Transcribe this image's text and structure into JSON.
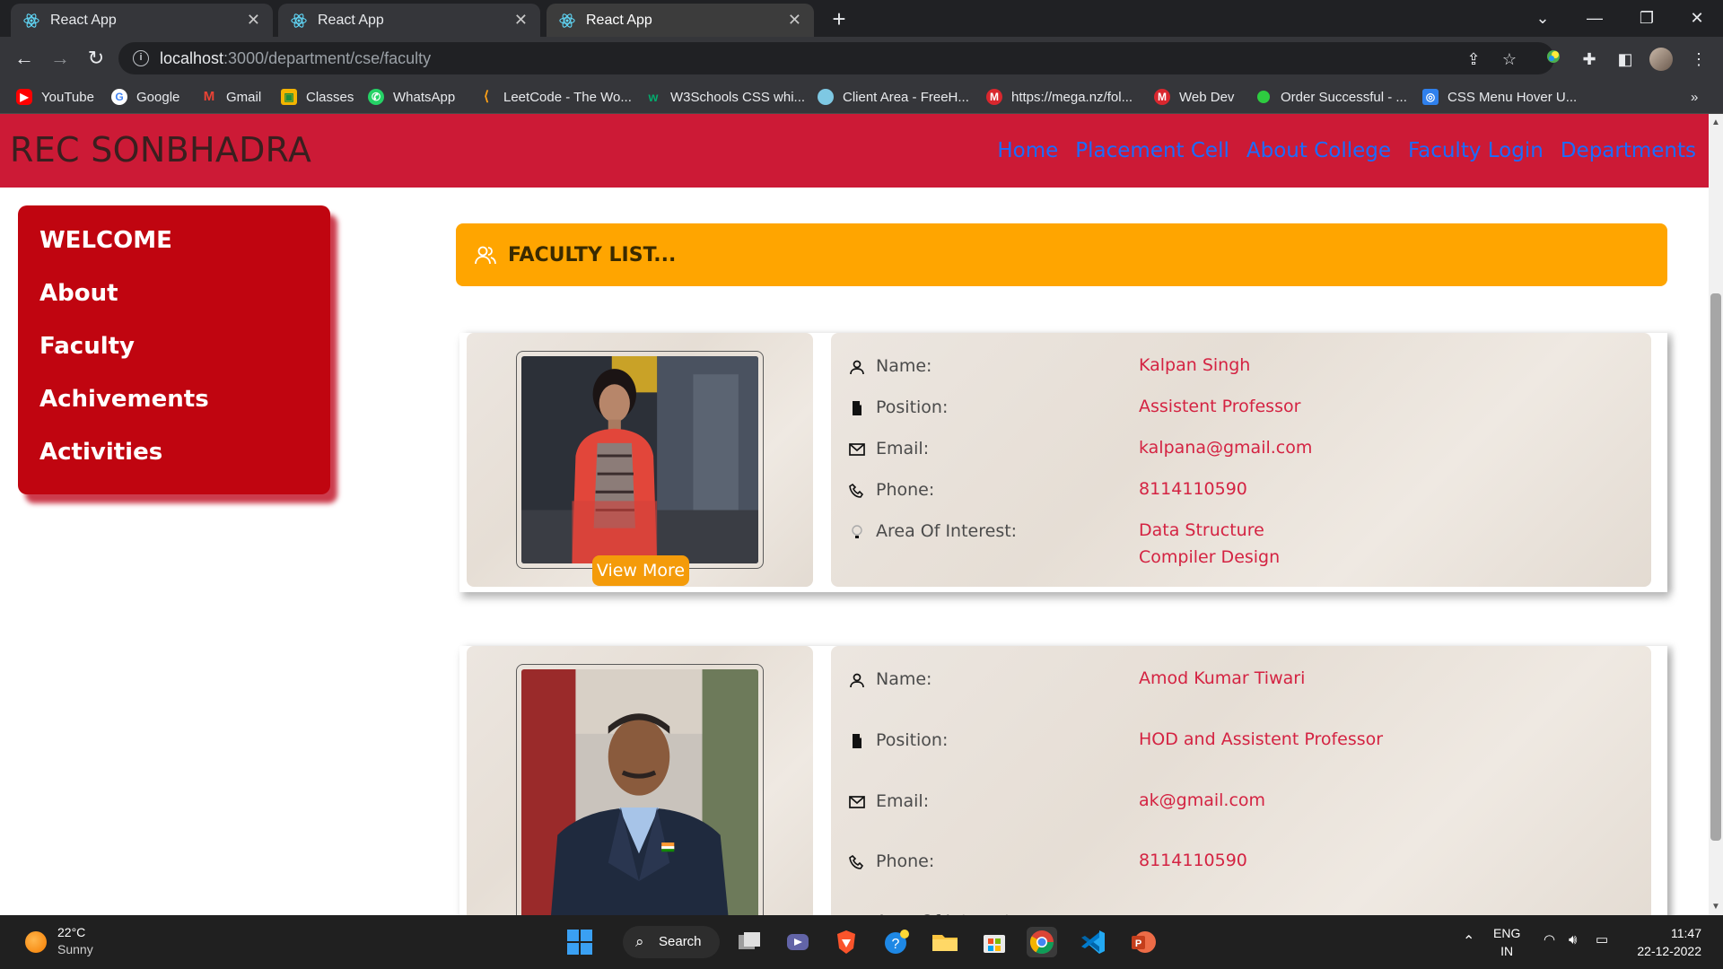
{
  "browser": {
    "tabs": [
      {
        "title": "React App",
        "active": false
      },
      {
        "title": "React App",
        "active": false
      },
      {
        "title": "React App",
        "active": true
      }
    ],
    "url_host": "localhost",
    "url_path": ":3000/department/cse/faculty",
    "bookmarks": [
      {
        "label": "YouTube",
        "icon": "youtube-icon",
        "color": "#ff0000"
      },
      {
        "label": "Google",
        "icon": "google-icon",
        "color": "#ffffff"
      },
      {
        "label": "Gmail",
        "icon": "gmail-icon",
        "color": "#ea4335"
      },
      {
        "label": "Classes",
        "icon": "classroom-icon",
        "color": "#f4b400"
      },
      {
        "label": "WhatsApp",
        "icon": "whatsapp-icon",
        "color": "#25d366"
      },
      {
        "label": "LeetCode - The Wo...",
        "icon": "leetcode-icon",
        "color": "#ffa116"
      },
      {
        "label": "W3Schools CSS whi...",
        "icon": "w3schools-icon",
        "color": "#04aa6d"
      },
      {
        "label": "Client Area - FreeH...",
        "icon": "freehosting-icon",
        "color": "#7ec8e3"
      },
      {
        "label": "https://mega.nz/fol...",
        "icon": "mega-icon",
        "color": "#d9272e"
      },
      {
        "label": "Web Dev",
        "icon": "mega-icon",
        "color": "#d9272e"
      },
      {
        "label": "Order Successful - ...",
        "icon": "green-dot-icon",
        "color": "#2ecc40"
      },
      {
        "label": "CSS Menu Hover U...",
        "icon": "css-menu-icon",
        "color": "#2f80ed"
      }
    ],
    "overflow": "»"
  },
  "site": {
    "brand": "REC SONBHADRA",
    "nav": [
      "Home",
      "Placement Cell",
      "About College",
      "Faculty Login",
      "Departments"
    ],
    "colors": {
      "header": "#cc1a36",
      "nav_link": "#1a6dff",
      "sidebar": "#c00510",
      "list_header": "#ffa500",
      "value_text": "#d42342"
    }
  },
  "sidebar": {
    "items": [
      "WELCOME",
      "About",
      "Faculty",
      "Achivements",
      "Activities"
    ]
  },
  "faculty_list": {
    "title": "FACULTY LIST...",
    "labels": {
      "name": "Name:",
      "position": "Position:",
      "email": "Email:",
      "phone": "Phone:",
      "interest": "Area Of Interest:"
    },
    "view_more": "View More",
    "faculty": [
      {
        "name": "Kalpan Singh",
        "position": "Assistent Professor",
        "email": "kalpana@gmail.com",
        "phone": "8114110590",
        "interests": [
          "Data Structure",
          "Compiler Design"
        ]
      },
      {
        "name": "Amod Kumar Tiwari",
        "position": "HOD and Assistent Professor",
        "email": "ak@gmail.com",
        "phone": "8114110590",
        "interests": []
      }
    ]
  },
  "taskbar": {
    "weather_temp": "22°C",
    "weather_desc": "Sunny",
    "search_label": "Search",
    "lang_top": "ENG",
    "lang_bottom": "IN",
    "time": "11:47",
    "date": "22-12-2022"
  }
}
